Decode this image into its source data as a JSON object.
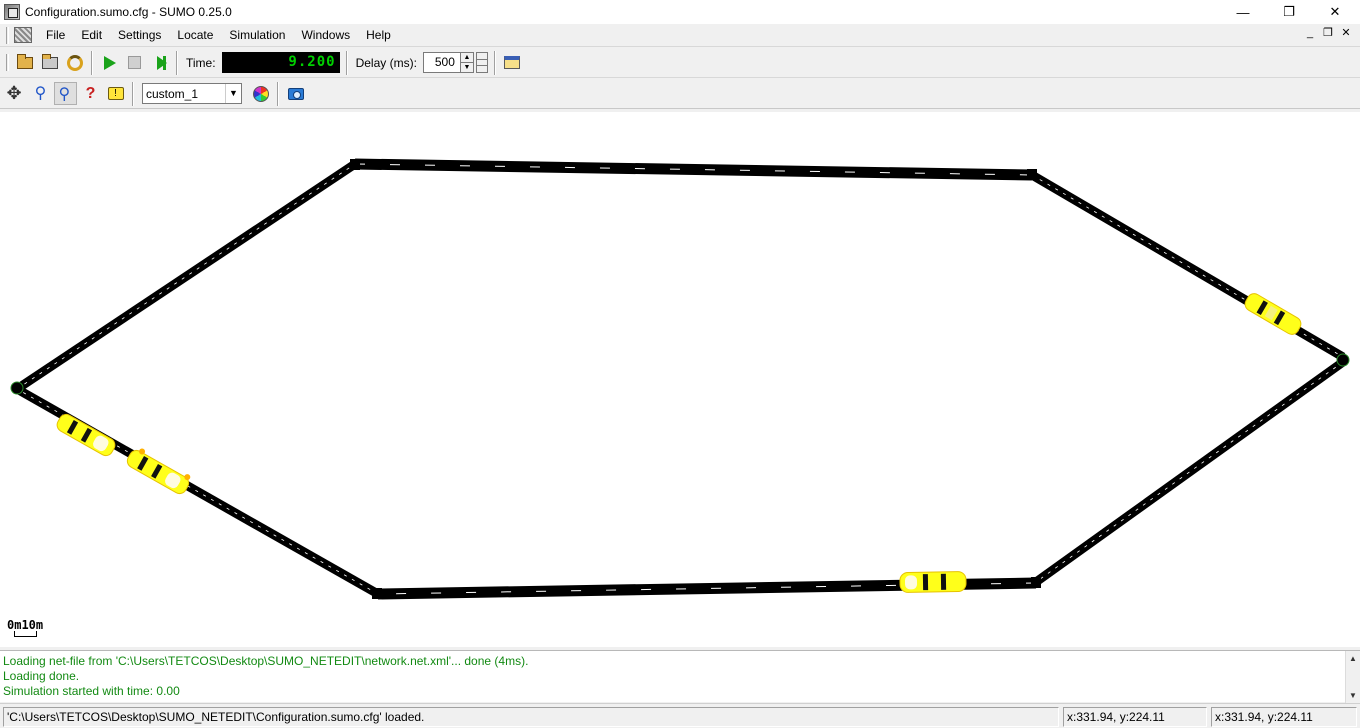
{
  "window": {
    "title": "Configuration.sumo.cfg - SUMO 0.25.0",
    "minimize": "—",
    "maximize": "❐",
    "close": "✕"
  },
  "menu": {
    "items": [
      "File",
      "Edit",
      "Settings",
      "Locate",
      "Simulation",
      "Windows",
      "Help"
    ],
    "mdi_minimize": "_",
    "mdi_restore": "❐",
    "mdi_close": "✕"
  },
  "toolbar": {
    "time_label": "Time:",
    "time_value": "9.200",
    "delay_label": "Delay (ms):",
    "delay_value": "500"
  },
  "view_toolbar": {
    "scheme_value": "custom_1"
  },
  "view": {
    "scale_label": "0m10m",
    "road_color": "#000000",
    "background_color": "#ffffff",
    "vehicle_color": "#ffff00",
    "vehicles": [
      {
        "id": "veh-right-upper"
      },
      {
        "id": "veh-left-1"
      },
      {
        "id": "veh-left-2"
      },
      {
        "id": "veh-bottom"
      }
    ]
  },
  "messages": {
    "lines": [
      "Loading net-file from 'C:\\Users\\TETCOS\\Desktop\\SUMO_NETEDIT\\network.net.xml'...  done (4ms).",
      "Loading done.",
      "Simulation started with time: 0.00"
    ],
    "color": "#138a13"
  },
  "statusbar": {
    "status_text": "'C:\\Users\\TETCOS\\Desktop\\SUMO_NETEDIT\\Configuration.sumo.cfg' loaded.",
    "coords_1": "x:331.94, y:224.11",
    "coords_2": "x:331.94, y:224.11"
  }
}
